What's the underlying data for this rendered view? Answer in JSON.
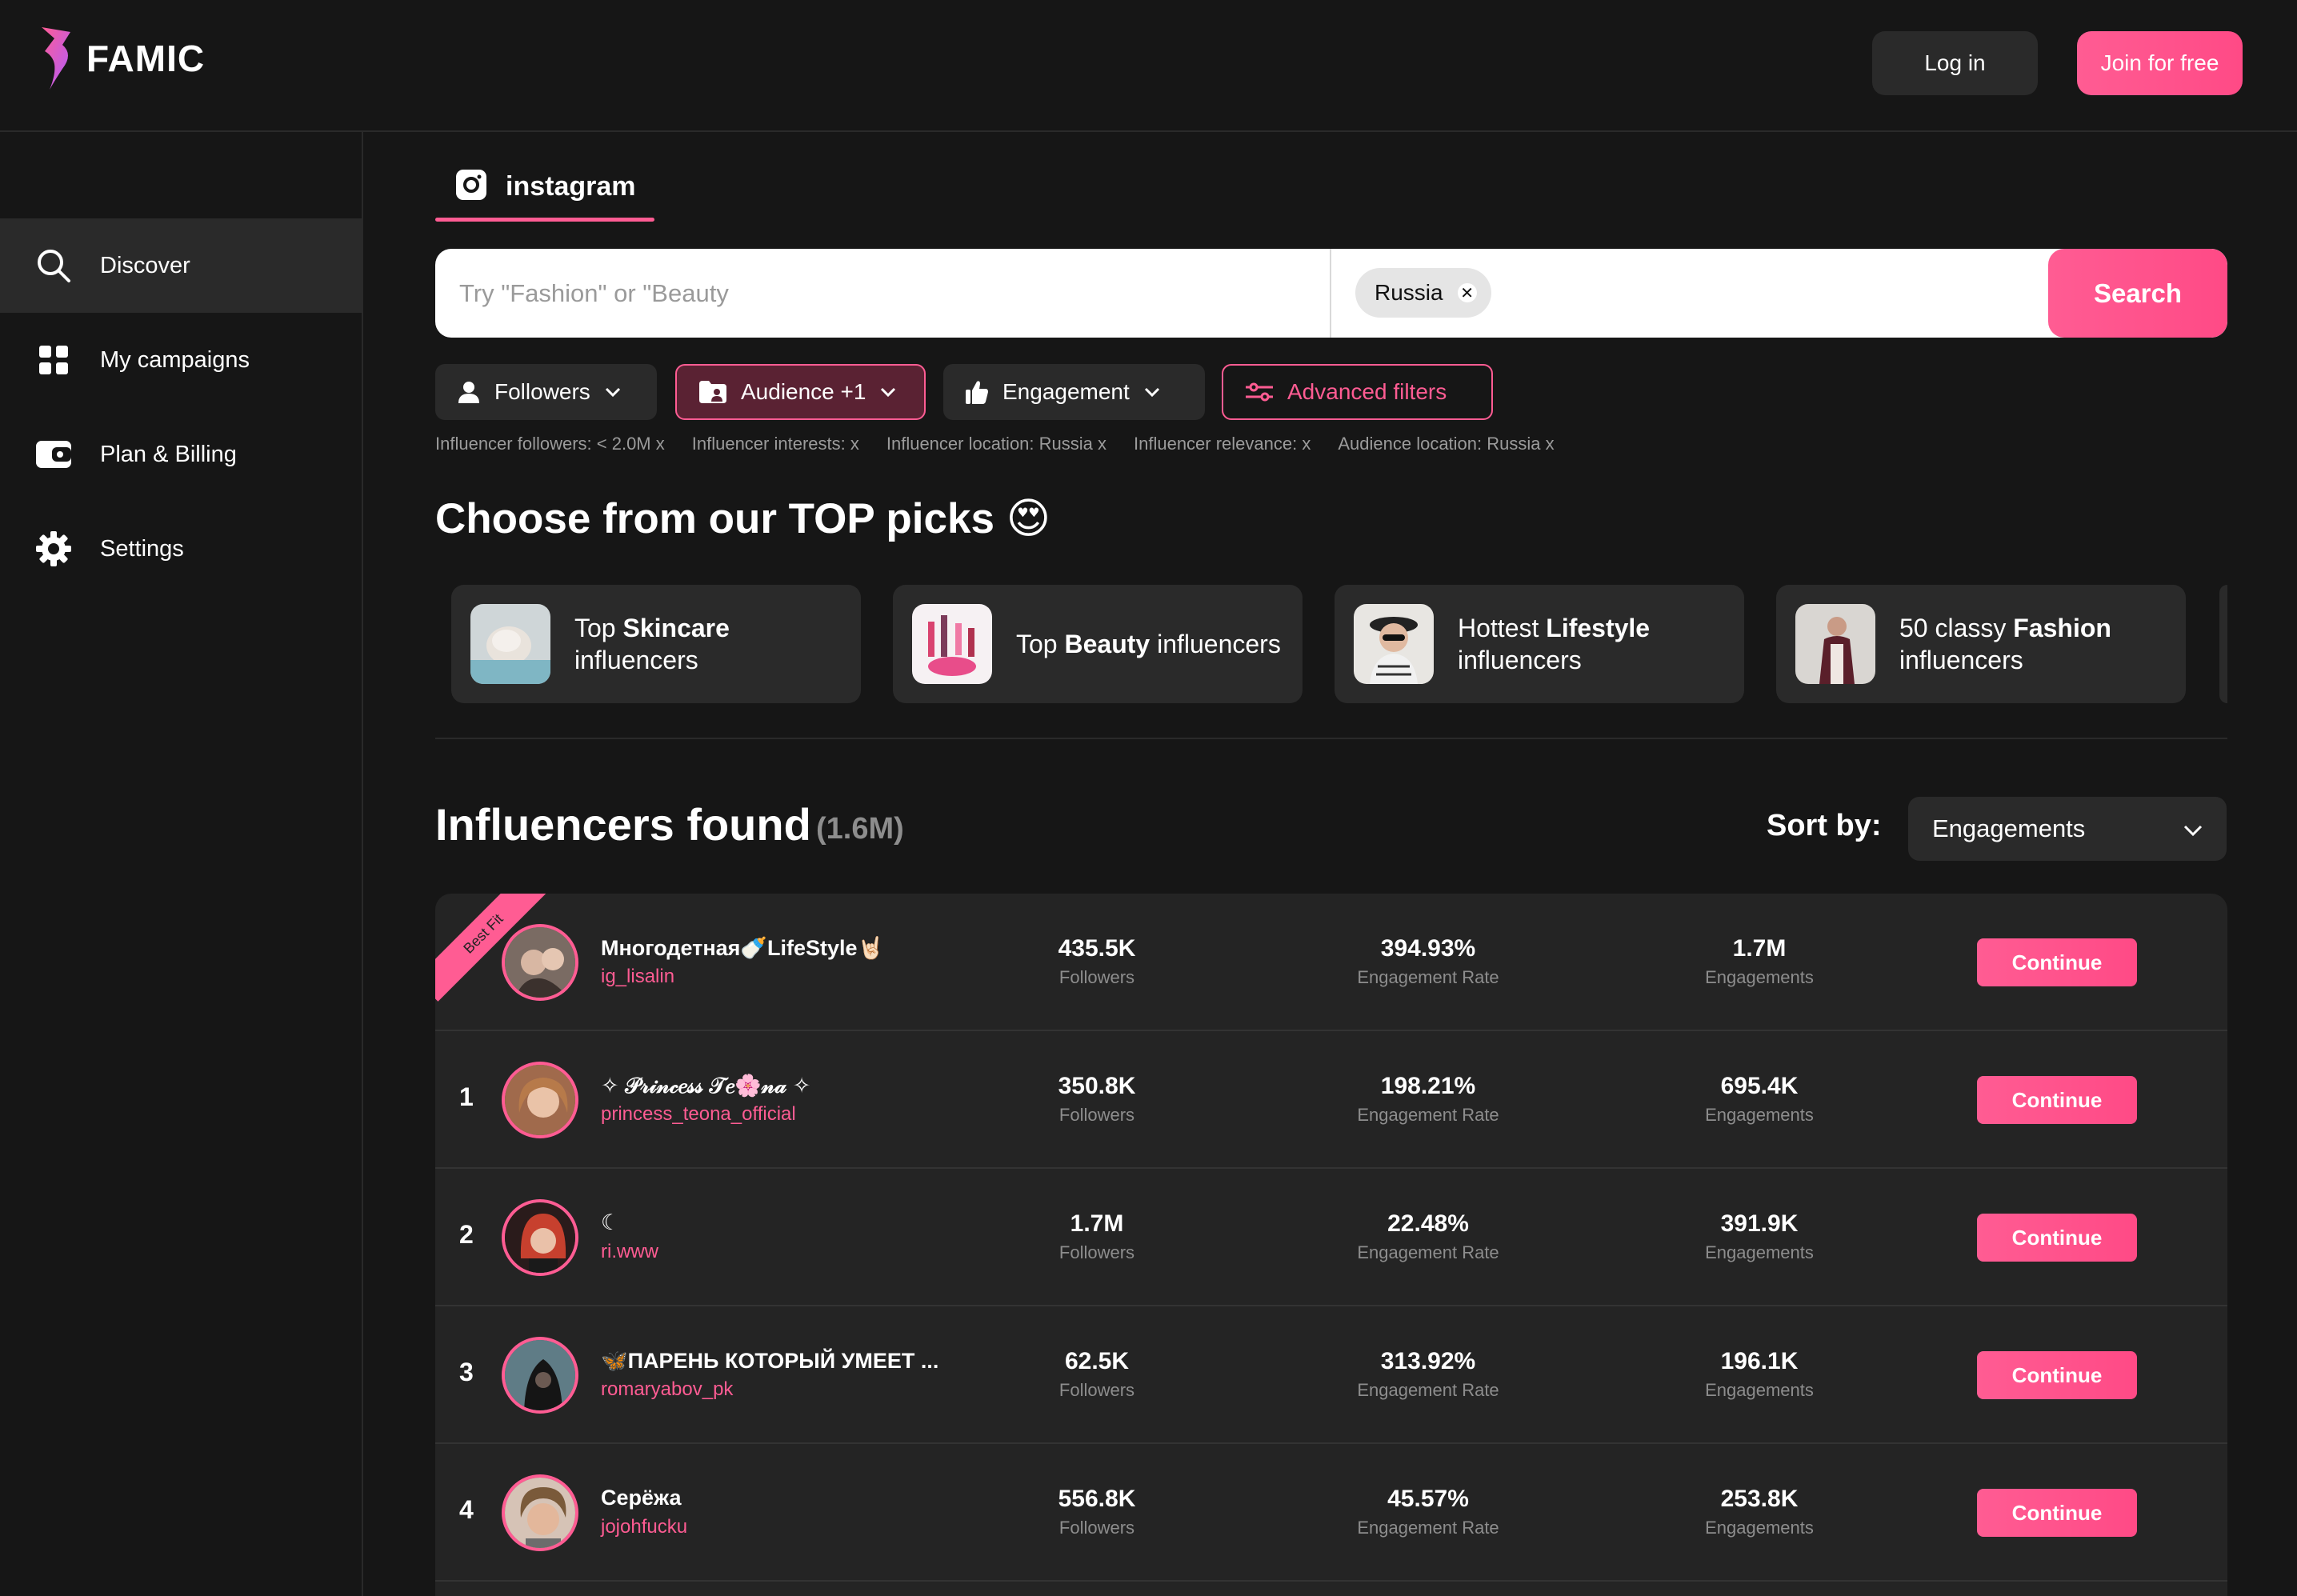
{
  "app": {
    "name": "FAMIC"
  },
  "header": {
    "login_label": "Log in",
    "join_label": "Join for free"
  },
  "sidebar": {
    "items": [
      {
        "label": "Discover",
        "icon": "search-icon",
        "active": true
      },
      {
        "label": "My campaigns",
        "icon": "grid-icon"
      },
      {
        "label": "Plan & Billing",
        "icon": "wallet-icon"
      },
      {
        "label": "Settings",
        "icon": "gear-icon"
      }
    ]
  },
  "platform_tab": {
    "label": "instagram",
    "icon": "instagram-icon"
  },
  "search": {
    "placeholder": "Try \"Fashion\" or \"Beauty",
    "location_chip": "Russia",
    "button_label": "Search"
  },
  "filters": {
    "followers": "Followers",
    "audience": "Audience +1",
    "engagement": "Engagement",
    "advanced": "Advanced filters"
  },
  "active_filters": [
    "Influencer followers: < 2.0M  x",
    "Influencer interests:  x",
    "Influencer location: Russia  x",
    "Influencer relevance:  x",
    "Audience location: Russia  x"
  ],
  "top_picks": {
    "title": "Choose from our TOP picks 😍",
    "cards": [
      {
        "pre": "Top ",
        "bold": "Skincare",
        "post": " influencers"
      },
      {
        "pre": "Top ",
        "bold": "Beauty",
        "post": " influencers"
      },
      {
        "pre": "Hottest ",
        "bold": "Lifestyle",
        "post": " influencers"
      },
      {
        "pre": "50 classy ",
        "bold": "Fashion",
        "post": " influencers"
      }
    ]
  },
  "results": {
    "title": "Influencers found",
    "count": "(1.6M)",
    "sort_label": "Sort by:",
    "sort_value": "Engagements",
    "continue_label": "Continue",
    "best_fit_label": "Best Fit",
    "col_followers": "Followers",
    "col_er": "Engagement Rate",
    "col_eng": "Engagements",
    "rows": [
      {
        "rank": "",
        "name": "Многодетная🍼LifeStyle🤘🏻",
        "handle": "ig_lisalin",
        "followers": "435.5K",
        "er": "394.93%",
        "eng": "1.7M",
        "best_fit": true
      },
      {
        "rank": "1",
        "name": "✧ 𝒫𝓇𝒾𝓃𝒸𝑒𝓈𝓈 𝒯𝑒🌸𝓃𝒶 ✧",
        "handle": "princess_teona_official",
        "followers": "350.8K",
        "er": "198.21%",
        "eng": "695.4K"
      },
      {
        "rank": "2",
        "name": "☾",
        "handle": "ri.www",
        "followers": "1.7M",
        "er": "22.48%",
        "eng": "391.9K"
      },
      {
        "rank": "3",
        "name": "🦋ПАРЕНЬ КОТОРЫЙ УМЕЕТ ...",
        "handle": "romaryabov_pk",
        "followers": "62.5K",
        "er": "313.92%",
        "eng": "196.1K"
      },
      {
        "rank": "4",
        "name": "Серёжа",
        "handle": "jojohfucku",
        "followers": "556.8K",
        "er": "45.57%",
        "eng": "253.8K"
      }
    ]
  },
  "colors": {
    "accent": "#ff5c93",
    "bg": "#161616",
    "panel": "#2a2a2a"
  }
}
